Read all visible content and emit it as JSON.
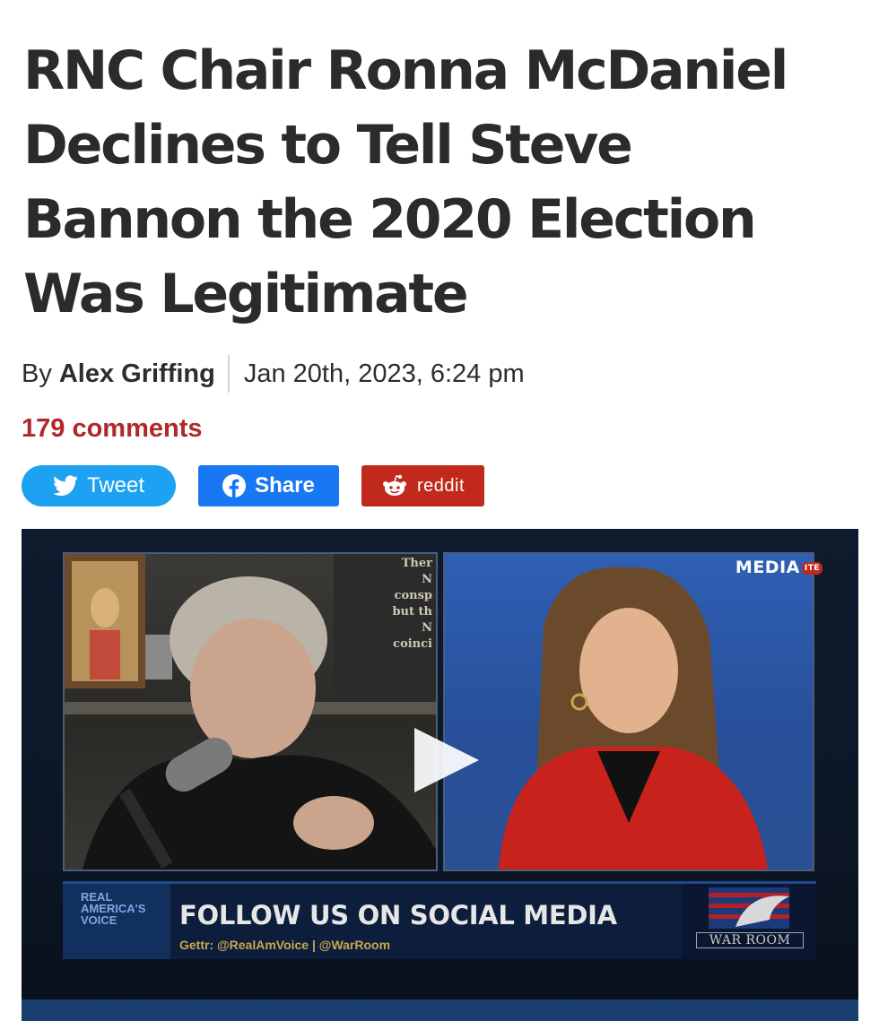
{
  "article": {
    "headline_lines": [
      "RNC Chair Ronna McDaniel",
      "Declines to Tell Steve",
      "Bannon the 2020 Election",
      "Was Legitimate"
    ],
    "by_prefix": "By",
    "author": "Alex Griffing",
    "date": "Jan 20th, 2023, 6:24 pm",
    "comments": "179 comments"
  },
  "share": {
    "tweet_label": "Tweet",
    "facebook_label": "Share",
    "reddit_label": "reddit"
  },
  "video": {
    "overlay_logo": "MEDIA",
    "overlay_logo_sub": "ITE",
    "book_lines": [
      "Ther",
      "N",
      "consp",
      "but th",
      "N",
      "coinci"
    ],
    "network_logo": [
      "REAL",
      "AMERICA'S",
      "VOICE"
    ],
    "lower_third_title": "FOLLOW US ON SOCIAL MEDIA",
    "lower_third_sub": "Gettr: @RealAmVoice | @WarRoom",
    "show_logo": "WAR ROOM"
  },
  "colors": {
    "accent_red": "#b0282b",
    "twitter_blue": "#1da1f2",
    "facebook_blue": "#1877f2",
    "reddit_red": "#c0291b"
  },
  "icons": [
    "twitter-bird-icon",
    "facebook-icon",
    "reddit-alien-icon",
    "play-icon"
  ]
}
